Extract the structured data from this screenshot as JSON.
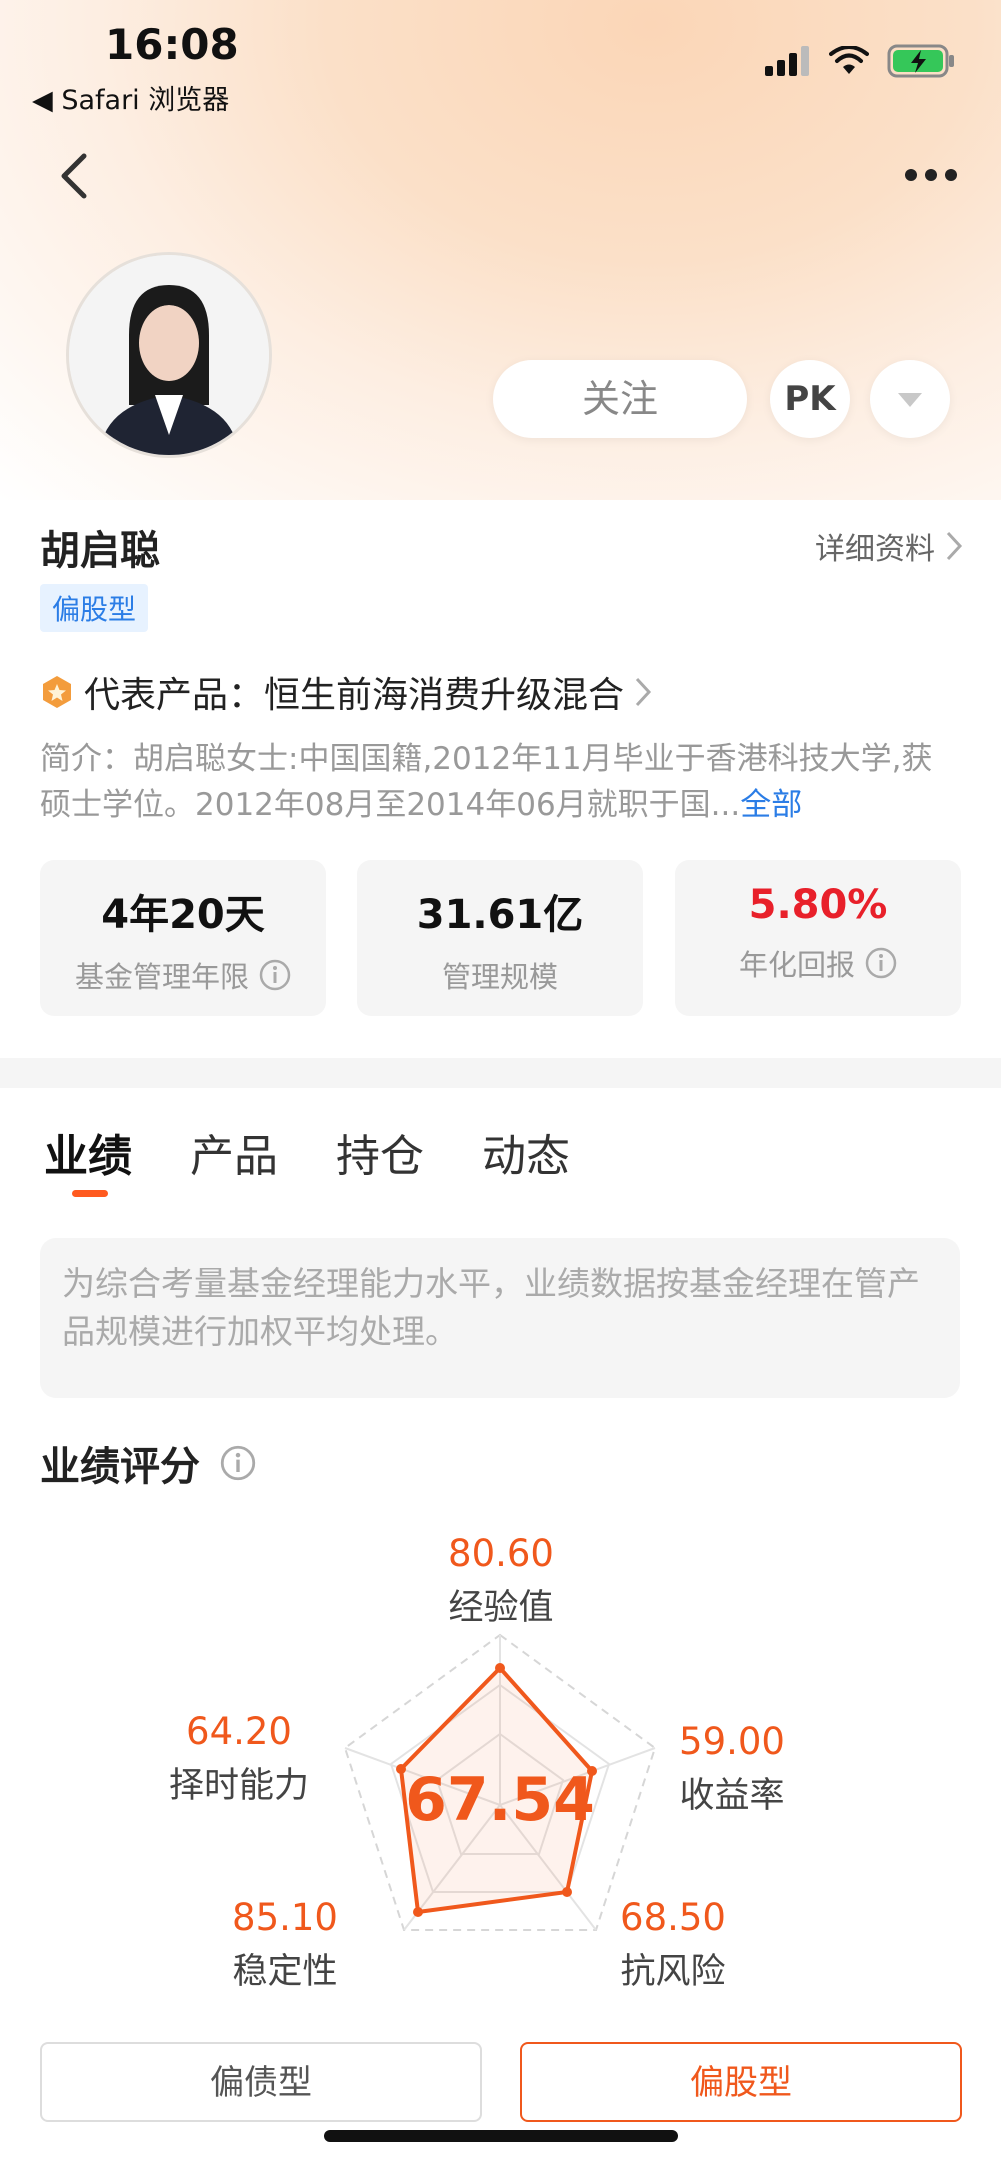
{
  "status_bar": {
    "time": "16:08",
    "back_app": "◀ Safari 浏览器"
  },
  "header": {
    "follow_label": "关注",
    "pk_label": "PK"
  },
  "manager": {
    "name": "胡启聪",
    "detail_link": "详细资料",
    "type_tag": "偏股型",
    "rep_product": "代表产品：恒生前海消费升级混合",
    "intro": "简介：胡启聪女士:中国国籍,2012年11月毕业于香港科技大学,获硕士学位。2012年08月至2014年06月就职于国...",
    "intro_more": "全部"
  },
  "stats": [
    {
      "value": "4年20天",
      "label": "基金管理年限",
      "color": "#111111",
      "info": true
    },
    {
      "value": "31.61亿",
      "label": "管理规模",
      "color": "#111111",
      "info": false
    },
    {
      "value": "5.80%",
      "label": "年化回报",
      "color": "#e8202a",
      "info": true
    }
  ],
  "tabs": [
    "业绩",
    "产品",
    "持仓",
    "动态"
  ],
  "notice": "为综合考量基金经理能力水平，业绩数据按基金经理在管产品规模进行加权平均处理。",
  "performance": {
    "title": "业绩评分",
    "score": "67.54",
    "dimensions": [
      {
        "name": "经验值",
        "value": "80.60"
      },
      {
        "name": "收益率",
        "value": "59.00"
      },
      {
        "name": "抗风险",
        "value": "68.50"
      },
      {
        "name": "稳定性",
        "value": "85.10"
      },
      {
        "name": "择时能力",
        "value": "64.20"
      }
    ]
  },
  "type_buttons": {
    "bond": "偏债型",
    "stock": "偏股型"
  },
  "colors": {
    "accent": "#f0581c",
    "link": "#2b7de6",
    "red": "#e8202a"
  }
}
